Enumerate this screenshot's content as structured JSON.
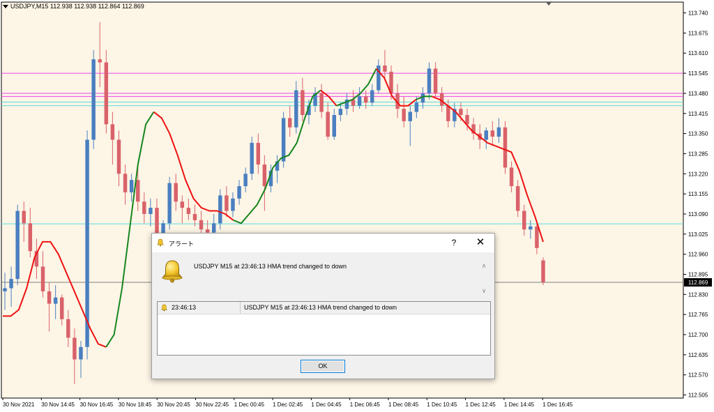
{
  "chart": {
    "symbol_label": "USDJPY,M15  112.938 112.938 112.864 112.869",
    "current_price_label": "112.869",
    "colors": {
      "background": "#fdf5e6",
      "bull_candle": "#4a7fc0",
      "bear_candle": "#d9626a",
      "hma_up": "#15851d",
      "hma_down": "#ee1111",
      "magenta_line": "#ee44ee",
      "cyan_line": "#55dddd",
      "grid_text": "#000000"
    },
    "icons": {
      "chart_marker": "triangle-down-icon",
      "dialog_icon": "bell-icon",
      "row_icon": "bell-icon"
    }
  },
  "chart_data": {
    "type": "candlestick",
    "symbol": "USDJPY,M15",
    "y_axis_labels": [
      "113.740",
      "113.675",
      "113.610",
      "113.545",
      "113.480",
      "113.415",
      "113.350",
      "113.285",
      "113.220",
      "113.155",
      "113.090",
      "113.025",
      "112.960",
      "112.895",
      "112.830",
      "112.765",
      "112.700",
      "112.635",
      "112.570",
      "112.505"
    ],
    "x_axis_labels": [
      "30 Nov 2021",
      "30 Nov 14:45",
      "30 Nov 16:45",
      "30 Nov 18:45",
      "30 Nov 20:45",
      "30 Nov 22:45",
      "1 Dec 00:45",
      "1 Dec 02:45",
      "1 Dec 04:45",
      "1 Dec 06:45",
      "1 Dec 08:45",
      "1 Dec 10:45",
      "1 Dec 12:45",
      "1 Dec 14:45",
      "1 Dec 16:45"
    ],
    "ylim": [
      112.495,
      113.775
    ],
    "current_price": 112.869,
    "horizontal_levels": [
      {
        "price": 113.545,
        "color": "#ee44ee"
      },
      {
        "price": 113.48,
        "color": "#ee44ee"
      },
      {
        "price": 113.47,
        "color": "#ee44ee"
      },
      {
        "price": 113.452,
        "color": "#55dddd"
      },
      {
        "price": 113.44,
        "color": "#55dddd"
      },
      {
        "price": 113.058,
        "color": "#55dddd"
      }
    ],
    "candles": [
      {
        "o": 112.84,
        "h": 112.9,
        "l": 112.78,
        "c": 112.85
      },
      {
        "o": 112.85,
        "h": 112.92,
        "l": 112.79,
        "c": 112.88
      },
      {
        "o": 112.88,
        "h": 113.12,
        "l": 112.86,
        "c": 113.1
      },
      {
        "o": 113.1,
        "h": 113.13,
        "l": 113.0,
        "c": 113.06
      },
      {
        "o": 113.06,
        "h": 113.11,
        "l": 112.95,
        "c": 112.97
      },
      {
        "o": 112.97,
        "h": 113.01,
        "l": 112.88,
        "c": 112.92
      },
      {
        "o": 112.92,
        "h": 112.97,
        "l": 112.82,
        "c": 112.84
      },
      {
        "o": 112.84,
        "h": 112.87,
        "l": 112.71,
        "c": 112.8
      },
      {
        "o": 112.8,
        "h": 112.86,
        "l": 112.75,
        "c": 112.82
      },
      {
        "o": 112.82,
        "h": 112.83,
        "l": 112.73,
        "c": 112.75
      },
      {
        "o": 112.75,
        "h": 112.78,
        "l": 112.66,
        "c": 112.69
      },
      {
        "o": 112.69,
        "h": 112.72,
        "l": 112.54,
        "c": 112.62
      },
      {
        "o": 112.62,
        "h": 112.68,
        "l": 112.56,
        "c": 112.66
      },
      {
        "o": 112.66,
        "h": 113.36,
        "l": 112.62,
        "c": 113.33
      },
      {
        "o": 113.33,
        "h": 113.62,
        "l": 113.3,
        "c": 113.59
      },
      {
        "o": 113.59,
        "h": 113.71,
        "l": 113.5,
        "c": 113.58
      },
      {
        "o": 113.58,
        "h": 113.62,
        "l": 113.35,
        "c": 113.38
      },
      {
        "o": 113.38,
        "h": 113.42,
        "l": 113.25,
        "c": 113.33
      },
      {
        "o": 113.33,
        "h": 113.36,
        "l": 113.18,
        "c": 113.22
      },
      {
        "o": 113.22,
        "h": 113.25,
        "l": 113.12,
        "c": 113.16
      },
      {
        "o": 113.16,
        "h": 113.22,
        "l": 113.13,
        "c": 113.2
      },
      {
        "o": 113.2,
        "h": 113.24,
        "l": 113.1,
        "c": 113.13
      },
      {
        "o": 113.13,
        "h": 113.16,
        "l": 113.06,
        "c": 113.09
      },
      {
        "o": 113.09,
        "h": 113.14,
        "l": 113.05,
        "c": 113.11
      },
      {
        "o": 113.11,
        "h": 113.14,
        "l": 113.0,
        "c": 113.02
      },
      {
        "o": 113.02,
        "h": 113.07,
        "l": 112.99,
        "c": 113.06
      },
      {
        "o": 113.06,
        "h": 113.21,
        "l": 113.04,
        "c": 113.19
      },
      {
        "o": 113.19,
        "h": 113.22,
        "l": 113.1,
        "c": 113.13
      },
      {
        "o": 113.13,
        "h": 113.15,
        "l": 113.06,
        "c": 113.11
      },
      {
        "o": 113.11,
        "h": 113.14,
        "l": 113.07,
        "c": 113.09
      },
      {
        "o": 113.09,
        "h": 113.12,
        "l": 113.05,
        "c": 113.07
      },
      {
        "o": 113.07,
        "h": 113.1,
        "l": 113.02,
        "c": 113.04
      },
      {
        "o": 113.04,
        "h": 113.07,
        "l": 113.01,
        "c": 113.03
      },
      {
        "o": 113.03,
        "h": 113.09,
        "l": 113.02,
        "c": 113.06
      },
      {
        "o": 113.06,
        "h": 113.17,
        "l": 113.04,
        "c": 113.15
      },
      {
        "o": 113.15,
        "h": 113.18,
        "l": 113.08,
        "c": 113.1
      },
      {
        "o": 113.1,
        "h": 113.16,
        "l": 113.08,
        "c": 113.14
      },
      {
        "o": 113.14,
        "h": 113.2,
        "l": 113.12,
        "c": 113.18
      },
      {
        "o": 113.18,
        "h": 113.24,
        "l": 113.16,
        "c": 113.22
      },
      {
        "o": 113.22,
        "h": 113.34,
        "l": 113.2,
        "c": 113.32
      },
      {
        "o": 113.32,
        "h": 113.35,
        "l": 113.22,
        "c": 113.25
      },
      {
        "o": 113.25,
        "h": 113.28,
        "l": 113.1,
        "c": 113.18
      },
      {
        "o": 113.18,
        "h": 113.25,
        "l": 113.16,
        "c": 113.23
      },
      {
        "o": 113.23,
        "h": 113.28,
        "l": 113.19,
        "c": 113.26
      },
      {
        "o": 113.26,
        "h": 113.42,
        "l": 113.24,
        "c": 113.4
      },
      {
        "o": 113.4,
        "h": 113.44,
        "l": 113.34,
        "c": 113.37
      },
      {
        "o": 113.37,
        "h": 113.52,
        "l": 113.35,
        "c": 113.49
      },
      {
        "o": 113.49,
        "h": 113.53,
        "l": 113.39,
        "c": 113.41
      },
      {
        "o": 113.41,
        "h": 113.46,
        "l": 113.38,
        "c": 113.44
      },
      {
        "o": 113.44,
        "h": 113.5,
        "l": 113.42,
        "c": 113.48
      },
      {
        "o": 113.48,
        "h": 113.51,
        "l": 113.4,
        "c": 113.42
      },
      {
        "o": 113.42,
        "h": 113.45,
        "l": 113.33,
        "c": 113.34
      },
      {
        "o": 113.34,
        "h": 113.43,
        "l": 113.33,
        "c": 113.41
      },
      {
        "o": 113.41,
        "h": 113.45,
        "l": 113.39,
        "c": 113.43
      },
      {
        "o": 113.43,
        "h": 113.48,
        "l": 113.41,
        "c": 113.46
      },
      {
        "o": 113.46,
        "h": 113.49,
        "l": 113.42,
        "c": 113.44
      },
      {
        "o": 113.44,
        "h": 113.5,
        "l": 113.43,
        "c": 113.47
      },
      {
        "o": 113.47,
        "h": 113.49,
        "l": 113.43,
        "c": 113.45
      },
      {
        "o": 113.45,
        "h": 113.51,
        "l": 113.44,
        "c": 113.49
      },
      {
        "o": 113.49,
        "h": 113.59,
        "l": 113.48,
        "c": 113.57
      },
      {
        "o": 113.57,
        "h": 113.62,
        "l": 113.53,
        "c": 113.55
      },
      {
        "o": 113.55,
        "h": 113.57,
        "l": 113.46,
        "c": 113.48
      },
      {
        "o": 113.48,
        "h": 113.51,
        "l": 113.4,
        "c": 113.43
      },
      {
        "o": 113.43,
        "h": 113.47,
        "l": 113.37,
        "c": 113.39
      },
      {
        "o": 113.39,
        "h": 113.44,
        "l": 113.31,
        "c": 113.42
      },
      {
        "o": 113.42,
        "h": 113.47,
        "l": 113.4,
        "c": 113.45
      },
      {
        "o": 113.45,
        "h": 113.5,
        "l": 113.43,
        "c": 113.48
      },
      {
        "o": 113.48,
        "h": 113.58,
        "l": 113.46,
        "c": 113.56
      },
      {
        "o": 113.56,
        "h": 113.58,
        "l": 113.47,
        "c": 113.48
      },
      {
        "o": 113.48,
        "h": 113.5,
        "l": 113.42,
        "c": 113.44
      },
      {
        "o": 113.44,
        "h": 113.46,
        "l": 113.37,
        "c": 113.39
      },
      {
        "o": 113.39,
        "h": 113.45,
        "l": 113.37,
        "c": 113.43
      },
      {
        "o": 113.43,
        "h": 113.45,
        "l": 113.39,
        "c": 113.41
      },
      {
        "o": 113.41,
        "h": 113.43,
        "l": 113.36,
        "c": 113.38
      },
      {
        "o": 113.38,
        "h": 113.4,
        "l": 113.33,
        "c": 113.35
      },
      {
        "o": 113.35,
        "h": 113.38,
        "l": 113.3,
        "c": 113.33
      },
      {
        "o": 113.33,
        "h": 113.37,
        "l": 113.3,
        "c": 113.36
      },
      {
        "o": 113.36,
        "h": 113.39,
        "l": 113.31,
        "c": 113.34
      },
      {
        "o": 113.34,
        "h": 113.4,
        "l": 113.32,
        "c": 113.37
      },
      {
        "o": 113.37,
        "h": 113.39,
        "l": 113.22,
        "c": 113.24
      },
      {
        "o": 113.24,
        "h": 113.26,
        "l": 113.16,
        "c": 113.18
      },
      {
        "o": 113.18,
        "h": 113.2,
        "l": 113.08,
        "c": 113.1
      },
      {
        "o": 113.1,
        "h": 113.12,
        "l": 113.02,
        "c": 113.04
      },
      {
        "o": 113.04,
        "h": 113.07,
        "l": 113.01,
        "c": 113.05
      },
      {
        "o": 113.05,
        "h": 113.06,
        "l": 112.96,
        "c": 112.98
      },
      {
        "o": 112.94,
        "h": 112.95,
        "l": 112.86,
        "c": 112.87
      }
    ],
    "hma_series": [
      {
        "name": "HMA down",
        "color": "#ee1111",
        "y": [
          112.76,
          112.76,
          112.78,
          112.85,
          112.95,
          113.0,
          113.0,
          112.96,
          112.9,
          112.84,
          112.78,
          112.72,
          112.67,
          112.66
        ]
      },
      {
        "name": "HMA up",
        "color": "#15851d",
        "y": [
          112.66,
          112.7,
          112.85,
          113.05,
          113.25,
          113.38,
          113.42
        ]
      },
      {
        "name": "HMA down",
        "color": "#ee1111",
        "y": [
          113.42,
          113.4,
          113.35,
          113.28,
          113.2,
          113.14,
          113.11,
          113.1,
          113.1,
          113.09,
          113.07
        ]
      },
      {
        "name": "HMA up",
        "color": "#15851d",
        "y": [
          113.07,
          113.06,
          113.09,
          113.12,
          113.17,
          113.24,
          113.27,
          113.28,
          113.32,
          113.4,
          113.47,
          113.49
        ]
      },
      {
        "name": "HMA down",
        "color": "#ee1111",
        "y": [
          113.49,
          113.47,
          113.44
        ]
      },
      {
        "name": "HMA up",
        "color": "#15851d",
        "y": [
          113.44,
          113.45,
          113.46,
          113.48,
          113.51,
          113.56
        ]
      },
      {
        "name": "HMA down",
        "color": "#ee1111",
        "y": [
          113.56,
          113.53,
          113.47,
          113.44,
          113.44,
          113.46
        ]
      },
      {
        "name": "HMA up",
        "color": "#15851d",
        "y": [
          113.46,
          113.47,
          113.47
        ]
      },
      {
        "name": "HMA down",
        "color": "#ee1111",
        "y": [
          113.47,
          113.46,
          113.44,
          113.42,
          113.39,
          113.36,
          113.34,
          113.32,
          113.31,
          113.3,
          113.29,
          113.23,
          113.15,
          113.08,
          113.0
        ]
      }
    ]
  },
  "dialog": {
    "title": "アラート",
    "help_label": "?",
    "close_label": "✕",
    "message": "USDJPY M15 at 23:46:13 HMA trend changed to down",
    "scroll_up": "∧",
    "scroll_down": "∨",
    "list": {
      "rows": [
        {
          "time": "23:46:13",
          "message": "USDJPY M15 at 23:46:13 HMA trend changed to down"
        }
      ]
    },
    "ok_label": "OK"
  }
}
